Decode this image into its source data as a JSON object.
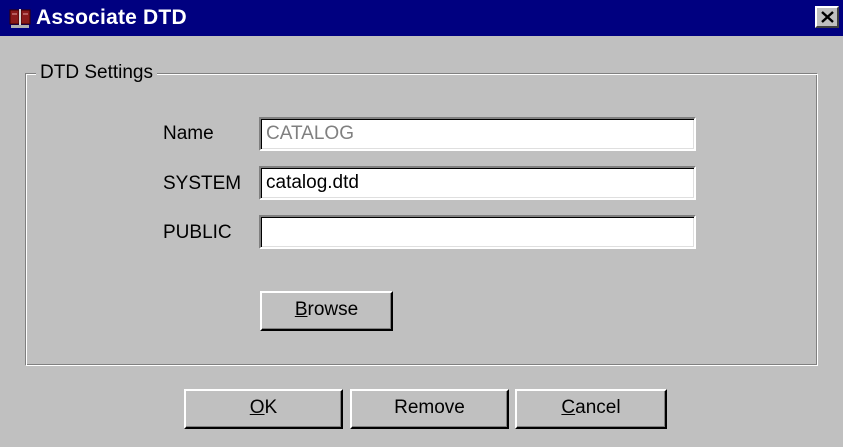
{
  "window": {
    "title": "Associate DTD",
    "app_icon": "dtd-app-icon",
    "close_icon": "close-icon"
  },
  "group": {
    "legend": "DTD Settings"
  },
  "fields": {
    "name_label": "Name",
    "name_value": "CATALOG",
    "system_label": "SYSTEM",
    "system_value": "catalog.dtd",
    "public_label": "PUBLIC",
    "public_value": ""
  },
  "buttons": {
    "browse": {
      "mnemonic": "B",
      "rest": "rowse"
    },
    "ok": {
      "mnemonic": "O",
      "rest": "K"
    },
    "remove": "Remove",
    "cancel": {
      "mnemonic": "C",
      "rest": "ancel"
    }
  },
  "colors": {
    "titlebar": "#000080",
    "face": "#c0c0c0",
    "disabled_text": "#808080"
  }
}
